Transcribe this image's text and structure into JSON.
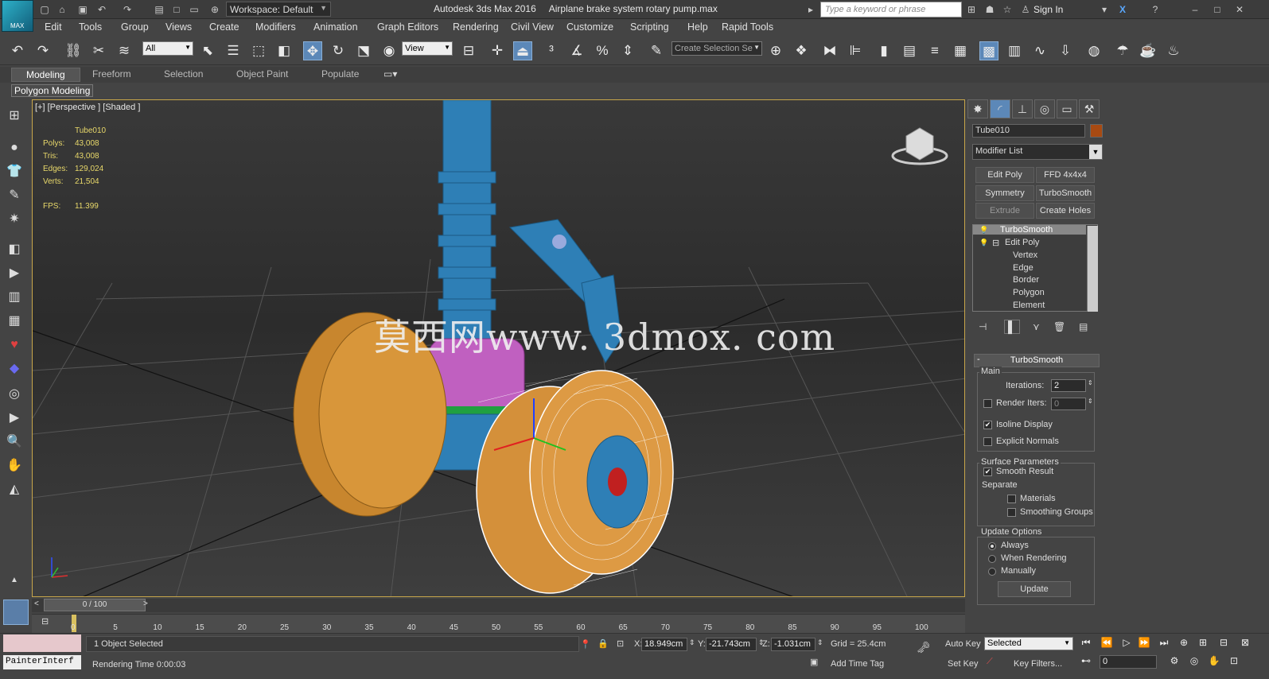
{
  "title_bar": {
    "workspace": "Workspace: Default",
    "app_title": "Autodesk 3ds Max 2016     Airplane brake system rotary pump.max",
    "search_placeholder": "Type a keyword or phrase",
    "sign_in": "Sign In",
    "logo_text": "MAX"
  },
  "menu": [
    "Edit",
    "Tools",
    "Group",
    "Views",
    "Create",
    "Modifiers",
    "Animation",
    "Graph Editors",
    "Rendering",
    "Civil View",
    "Customize",
    "Scripting",
    "Help",
    "Rapid Tools"
  ],
  "toolbar": {
    "filter": "All",
    "ref_coord": "View",
    "selection_set": "Create Selection Se"
  },
  "ribbon": {
    "tabs": [
      "Modeling",
      "Freeform",
      "Selection",
      "Object Paint",
      "Populate"
    ],
    "active_tab": "Modeling",
    "subtab": "Polygon Modeling"
  },
  "viewport": {
    "label": "[+] [Perspective ] [Shaded ]",
    "object_name": "Tube010",
    "stats": [
      {
        "label": "Polys:",
        "value": "43,008"
      },
      {
        "label": "Tris:",
        "value": "43,008"
      },
      {
        "label": "Edges:",
        "value": "129,024"
      },
      {
        "label": "Verts:",
        "value": "21,504"
      }
    ],
    "fps_label": "FPS:",
    "fps_value": "11.399",
    "watermark": "莫西网www. 3dmox. com"
  },
  "command_panel": {
    "object_name": "Tube010",
    "object_color": "#a84a12",
    "modifier_list": "Modifier List",
    "modifier_buttons": [
      "Edit Poly",
      "FFD 4x4x4",
      "Symmetry",
      "TurboSmooth",
      "Extrude",
      "Create Holes"
    ],
    "stack": [
      "TurboSmooth",
      "Edit Poly",
      "Vertex",
      "Edge",
      "Border",
      "Polygon",
      "Element"
    ],
    "rollout_title": "TurboSmooth",
    "main_group": "Main",
    "iterations_label": "Iterations:",
    "iterations_value": "2",
    "render_iters_label": "Render Iters:",
    "render_iters_value": "0",
    "isoline_label": "Isoline Display",
    "isoline_checked": true,
    "explicit_label": "Explicit Normals",
    "explicit_checked": false,
    "surface_group": "Surface Parameters",
    "smooth_result_label": "Smooth Result",
    "smooth_result_checked": true,
    "separate_label": "Separate",
    "materials_label": "Materials",
    "smoothing_groups_label": "Smoothing Groups",
    "update_group": "Update Options",
    "update_options": [
      "Always",
      "When Rendering",
      "Manually"
    ],
    "update_selected": "Always",
    "update_button": "Update"
  },
  "timeline": {
    "frame": "0 / 100",
    "ticks": [
      "0",
      "5",
      "10",
      "15",
      "20",
      "25",
      "30",
      "35",
      "40",
      "45",
      "50",
      "55",
      "60",
      "65",
      "70",
      "75",
      "80",
      "85",
      "90",
      "95",
      "100"
    ]
  },
  "status": {
    "maxscript": "PainterInterf",
    "selection": "1 Object Selected",
    "rendering_time": "Rendering Time  0:00:03",
    "x_label": "X:",
    "x": "18.949cm",
    "y_label": "Y:",
    "y": "-21.743cm",
    "z_label": "Z:",
    "z": "-1.031cm",
    "grid": "Grid = 25.4cm",
    "add_time_tag": "Add Time Tag",
    "auto_key": "Auto Key",
    "set_key": "Set Key",
    "key_mode": "Selected",
    "key_filters": "Key Filters...",
    "current_frame": "0"
  }
}
